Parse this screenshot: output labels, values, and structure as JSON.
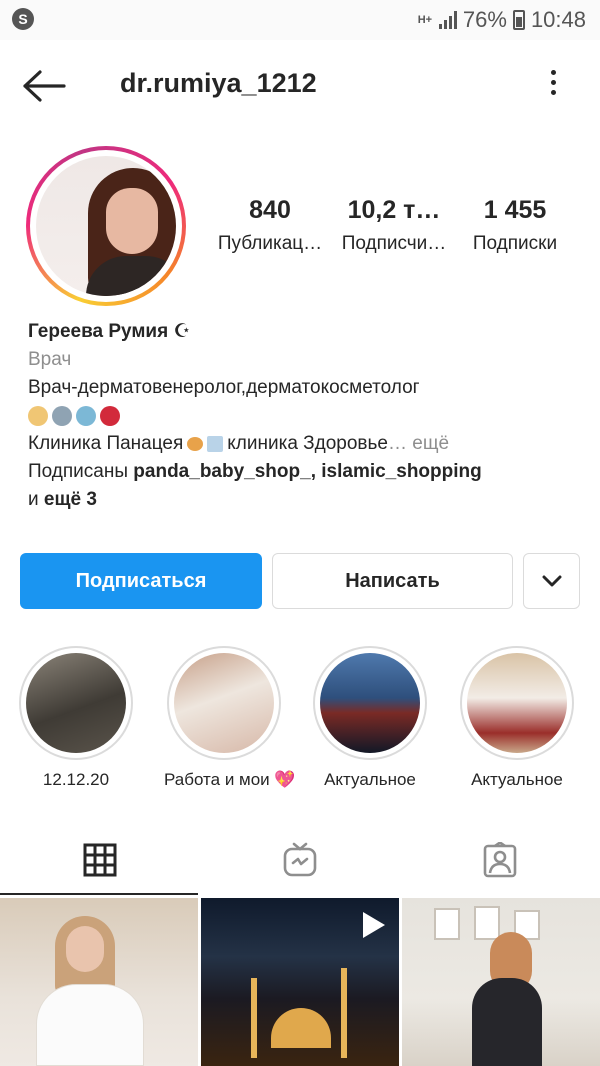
{
  "status_bar": {
    "network": "H+",
    "battery_percent": "76%",
    "time": "10:48"
  },
  "header": {
    "username": "dr.rumiya_1212"
  },
  "profile": {
    "stats": [
      {
        "value": "840",
        "label": "Публикац…"
      },
      {
        "value": "10,2 т…",
        "label": "Подписчи…"
      },
      {
        "value": "1 455",
        "label": "Подписки"
      }
    ],
    "name": "Гереева Румия ☪",
    "category": "Врач",
    "bio_line1": "Врач-дерматовенеролог,дерматокосметолог",
    "bio_line3": "Клиника Панацея",
    "bio_line3b": "клиника Здоровье",
    "more_link": "… ещё",
    "followed_by_prefix": "Подписаны ",
    "followed_user1": "panda_baby_shop_",
    "followed_user2": "islamic_shopping",
    "followed_and": "и ",
    "followed_more": "ещё 3"
  },
  "actions": {
    "follow_label": "Подписаться",
    "message_label": "Написать"
  },
  "highlights": [
    {
      "label": "12.12.20"
    },
    {
      "label": "Работа и мои 💖"
    },
    {
      "label": "Актуальное"
    },
    {
      "label": "Актуальное"
    }
  ],
  "tabs": [
    "grid-tab",
    "igtv-tab",
    "tagged-tab"
  ],
  "colors": {
    "accent": "#1a95f1",
    "text": "#262626",
    "secondary": "#8e8e8e",
    "border": "#dbdbdb"
  }
}
